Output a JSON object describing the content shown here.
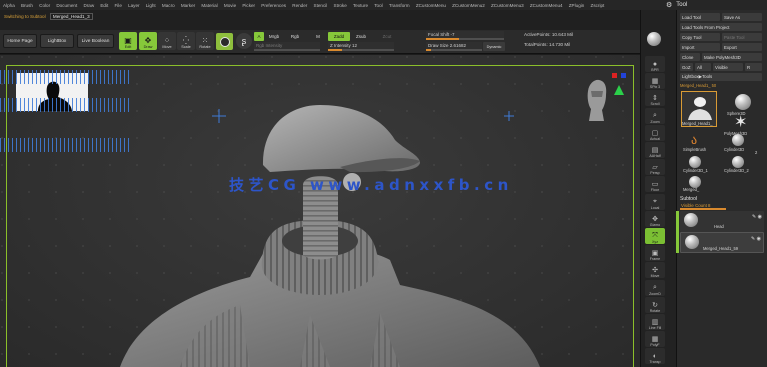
{
  "menu": [
    "Alpha",
    "Brush",
    "Color",
    "Document",
    "Draw",
    "Edit",
    "File",
    "Layer",
    "Light",
    "Macro",
    "Marker",
    "Material",
    "Movie",
    "Picker",
    "Preferences",
    "Render",
    "Stencil",
    "Stroke",
    "Texture",
    "Tool",
    "Transform",
    "ZCustomMenu",
    "ZCustomMenu2",
    "ZCustomMenu3",
    "ZCustomMenu4",
    "ZPlugin",
    "Zscript"
  ],
  "tool_panel_title": "Tool",
  "document": {
    "title": "Merged_Head1_3",
    "prefix": "Switching to Subtool"
  },
  "shelf": {
    "home": "Home Page",
    "lightbox": "LightBox",
    "live_boolean": "Live Boolean",
    "buttons": {
      "edit": "Edit",
      "draw": "Draw",
      "move": "Move",
      "scale": "Scale",
      "rotate": "Rotate"
    },
    "a_label": "A",
    "mrgb": "Mrgb",
    "rgb": "Rgb",
    "m": "M",
    "zadd": "Zadd",
    "zsub": "Zsub",
    "zcut": "Zcut",
    "rgb_intensity": "Rgb Intensity",
    "z_intensity": "Z Intensity 12",
    "focal_shift": "Focal Shift -7",
    "draw_size": "Draw Size 2.61682",
    "dynamic": "Dynamic",
    "active_points": "ActivePoints: 10.643 Mil",
    "total_points": "TotalPoints: 14.730 Mil"
  },
  "viewport": {
    "watermark": "技艺CG  www.adnxxfb.cn"
  },
  "dock": [
    "BPR",
    "SPix 3",
    "Scroll",
    "Zoom",
    "Actual",
    "AAHalf",
    "Persp",
    "Floor",
    "Local",
    "Gizmo",
    "Xyz",
    "Frame",
    "Move",
    "ZoomD",
    "Rotate",
    "Line Fill",
    "PolyF",
    "Transp"
  ],
  "panel": {
    "load_tool": "Load Tool",
    "save_as": "Save As",
    "load_from_project": "Load Tools From Project",
    "copy_tool": "Copy Tool",
    "paste_tool": "Paste Tool",
    "import": "Import",
    "export": "Export",
    "clone": "Clone",
    "make_polymesh": "Make PolyMesh3D",
    "goz": "GoZ",
    "all": "All",
    "visible": "Visible",
    "r": "R",
    "lightbox_tools": "Lightbox▶Tools",
    "current_tool": "Merged_Head1_ 50",
    "tools": [
      {
        "name": "Merged_Head1_",
        "badge": ""
      },
      {
        "name": "Sphere3D",
        "badge": ""
      },
      {
        "name": "PolyMesh3D",
        "badge": ""
      },
      {
        "name": "SimpleBrush",
        "badge": ""
      },
      {
        "name": "Cylinder3D",
        "badge": ""
      },
      {
        "name": "Cylinder3D_1",
        "badge": "2"
      },
      {
        "name": "Cylinder3D_2",
        "badge": "2"
      },
      {
        "name": "Merged_",
        "badge": "2"
      }
    ],
    "subtool_title": "Subtool",
    "visible_count": "Visible Count 8",
    "subtools": [
      {
        "name": "Head"
      },
      {
        "name": "Merged_Head1_59"
      }
    ]
  },
  "colors": {
    "accent_green": "#86c83a",
    "accent_orange": "#d98a2e",
    "watermark_blue": "#2d55c9"
  }
}
